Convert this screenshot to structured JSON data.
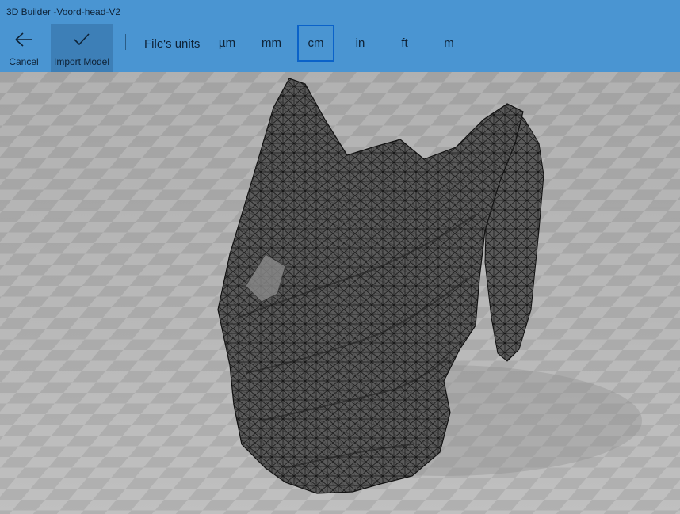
{
  "window": {
    "title": "3D Builder -Voord-head-V2"
  },
  "toolbar": {
    "cancel_label": "Cancel",
    "import_label": "Import Model",
    "units_label": "File's units",
    "units": [
      "µm",
      "mm",
      "cm",
      "in",
      "ft",
      "m"
    ],
    "selected_unit": "cm"
  },
  "icons": {
    "cancel": "back-arrow-icon",
    "import": "checkmark-icon"
  },
  "colors": {
    "accent": "#4a95d2",
    "selected_border": "#0a62c9",
    "floor_light": "#b9b9b9",
    "floor_dark": "#9f9f9f",
    "mesh": "#555555",
    "mesh_line": "#1a1a1a"
  }
}
